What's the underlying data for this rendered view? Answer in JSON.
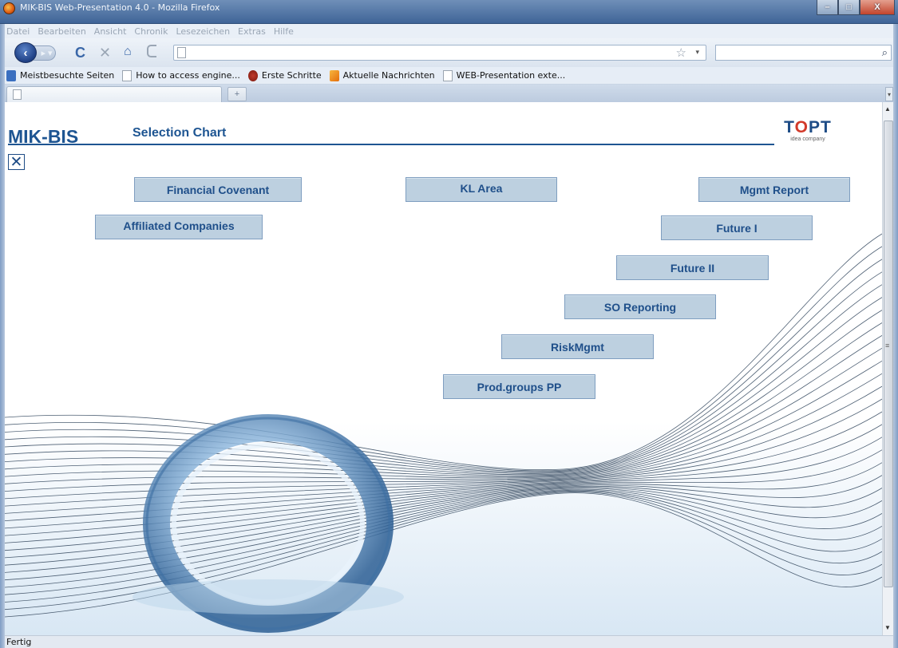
{
  "window": {
    "title": "MIK-BIS Web-Presentation 4.0 - Mozilla Firefox",
    "minimize": "–",
    "maximize": "□",
    "close": "X"
  },
  "menu": [
    "Datei",
    "Bearbeiten",
    "Ansicht",
    "Chronik",
    "Lesezeichen",
    "Extras",
    "Hilfe"
  ],
  "toolbar": {
    "url_value": "",
    "search_value": ""
  },
  "bookmarks": [
    {
      "label": "Meistbesuchte Seiten",
      "icon": "smart-folder-icon"
    },
    {
      "label": "How to access engine...",
      "icon": "page-icon"
    },
    {
      "label": "Erste Schritte",
      "icon": "firefox-icon"
    },
    {
      "label": "Aktuelle Nachrichten",
      "icon": "rss-icon"
    },
    {
      "label": "WEB-Presentation exte...",
      "icon": "page-icon"
    }
  ],
  "tab": {
    "label": "",
    "new_tab": "+"
  },
  "page": {
    "brand": "MIK-BIS",
    "subtitle": "Selection Chart",
    "logo_main_a": "T",
    "logo_main_o": "O",
    "logo_main_b": "PT",
    "logo_sub": "idea company",
    "close_symbol": "✕",
    "accent_color": "#1e5592",
    "button_fill": "#bdd0e0"
  },
  "buttons": {
    "financial_covenant": "Financial Covenant",
    "kl_area": "KL Area",
    "mgmt_report": "Mgmt Report",
    "affiliated_companies": "Affiliated Companies",
    "future_1": "Future I",
    "future_2": "Future II",
    "so_reporting": "SO Reporting",
    "riskmgmt": "RiskMgmt",
    "prod_groups_pp": "Prod.groups PP"
  },
  "status": {
    "text": "Fertig"
  }
}
